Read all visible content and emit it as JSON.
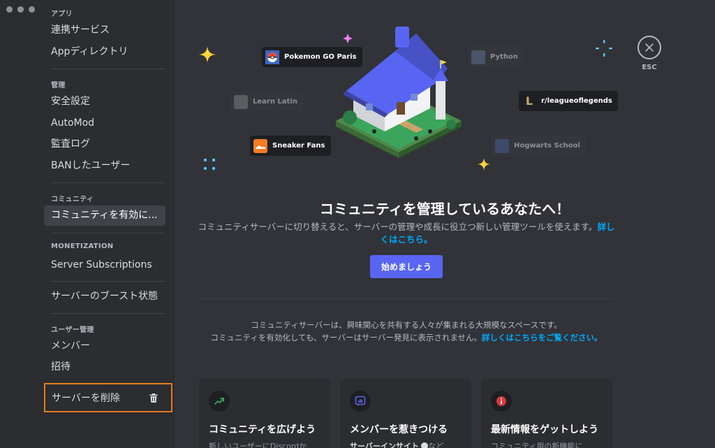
{
  "window": {
    "controls": [
      "close",
      "minimize",
      "zoom"
    ]
  },
  "sidebar": {
    "sections": {
      "apps": {
        "title": "アプリ",
        "items": [
          {
            "label": "連携サービス"
          },
          {
            "label": "Appディレクトリ"
          }
        ]
      },
      "moderation": {
        "title": "管理",
        "items": [
          {
            "label": "安全設定"
          },
          {
            "label": "AutoMod"
          },
          {
            "label": "監査ログ"
          },
          {
            "label": "BANしたユーザー"
          }
        ]
      },
      "community": {
        "title": "コミュニティ",
        "items": [
          {
            "label": "コミュニティを有効に...",
            "active": true
          }
        ]
      },
      "monetization": {
        "title": "MONETIZATION",
        "items": [
          {
            "label": "Server Subscriptions"
          }
        ]
      },
      "boost": {
        "items": [
          {
            "label": "サーバーのブースト状態"
          }
        ]
      },
      "users": {
        "title": "ユーザー管理",
        "items": [
          {
            "label": "メンバー"
          },
          {
            "label": "招待"
          }
        ]
      }
    },
    "delete": {
      "label": "サーバーを削除",
      "icon": "trash-icon",
      "highlight_color": "#e87a1d"
    }
  },
  "close": {
    "label": "ESC",
    "icon": "close-icon"
  },
  "illustration": {
    "tags": [
      {
        "label": "Pokemon GO Paris",
        "emphasis": "bright"
      },
      {
        "label": "Python",
        "emphasis": "dim"
      },
      {
        "label": "Learn Latin",
        "emphasis": "dim"
      },
      {
        "label": "r/leagueoflegends",
        "emphasis": "bright"
      },
      {
        "label": "Sneaker Fans",
        "emphasis": "bright"
      },
      {
        "label": "Hogwarts School",
        "emphasis": "dim"
      }
    ]
  },
  "hero": {
    "title": "コミュニティを管理しているあなたへ！",
    "description": "コミュニティサーバーに切り替えると、サーバーの管理や成長に役立つ新しい管理ツールを使えます。",
    "link": "詳しくはこちら。",
    "cta": "始めましょう"
  },
  "info": {
    "line1": "コミュニティサーバーは、興味関心を共有する人々が集まれる大規模なスペースです。",
    "line2": "コミュニティを有効化しても、サーバーはサーバー発見に表示されません。",
    "link": "詳しくはこちらをご覧ください。"
  },
  "cards": [
    {
      "title": "コミュニティを広げよう",
      "body": "新しいユーザーにDiscordか",
      "icon": "trending-up-icon",
      "color": "#248046"
    },
    {
      "title": "メンバーを惹きつける",
      "body": "サーバーインサイト",
      "body_suffix": "など",
      "icon": "insights-icon",
      "color": "#5865f2"
    },
    {
      "title": "最新情報をゲットしよう",
      "body": "コミュニティ用の新機能に",
      "icon": "info-icon",
      "color": "#da373c"
    }
  ],
  "colors": {
    "accent": "#5865f2",
    "link": "#00a8fc",
    "background": "#313338",
    "sidebar": "#2b2d31"
  }
}
